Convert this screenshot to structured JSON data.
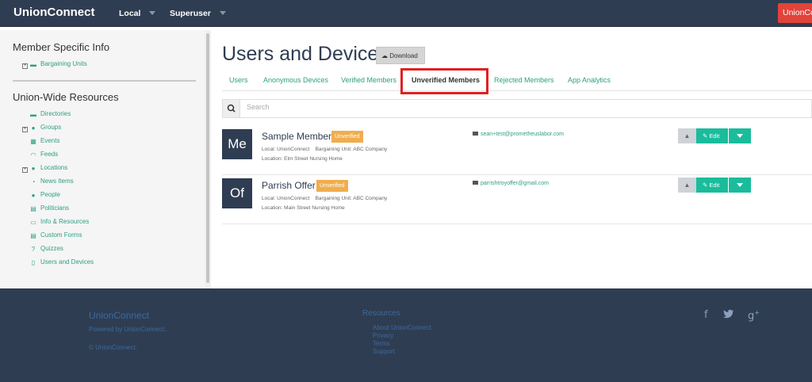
{
  "navbar": {
    "brand": "UnionConnect",
    "local_dropdown": "Local",
    "user_dropdown": "Superuser",
    "right_button": "UnionCo"
  },
  "sidebar": {
    "member_specific_heading": "Member Specific Info",
    "member_specific_items": [
      {
        "label": "Bargaining Units",
        "icon": "book-icon"
      }
    ],
    "union_wide_heading": "Union-Wide Resources",
    "union_wide_items": [
      {
        "label": "Directories",
        "icon": "book-icon"
      },
      {
        "label": "Groups",
        "icon": "users-icon"
      },
      {
        "label": "Events",
        "icon": "calendar-icon"
      },
      {
        "label": "Feeds",
        "icon": "rss-icon"
      },
      {
        "label": "Locations",
        "icon": "globe-icon"
      },
      {
        "label": "News Items",
        "icon": "clock-icon"
      },
      {
        "label": "People",
        "icon": "person-icon"
      },
      {
        "label": "Politicians",
        "icon": "document-icon"
      },
      {
        "label": "Info & Resources",
        "icon": "folder-icon"
      },
      {
        "label": "Custom Forms",
        "icon": "list-icon"
      },
      {
        "label": "Quizzes",
        "icon": "question-icon"
      },
      {
        "label": "Users and Devices",
        "icon": "device-icon"
      }
    ]
  },
  "main": {
    "title": "Users and Devices",
    "download_label": "Download",
    "tabs": [
      {
        "label": "Users"
      },
      {
        "label": "Anonymous Devices"
      },
      {
        "label": "Verified Members"
      },
      {
        "label": "Unverified Members"
      },
      {
        "label": "Rejected Members"
      },
      {
        "label": "App Analytics"
      }
    ],
    "active_tab": "Unverified Members",
    "search_placeholder": "Search",
    "members": [
      {
        "initials": "Me",
        "name": "Sample Member",
        "badge": "Unverified",
        "local": "Local: UnionConnect",
        "bargaining_unit": "Bargaining Unit: ABC Company",
        "location": "Location: Elm Street Nursing Home",
        "email": "sean+test@prometheuslabor.com",
        "edit_label": "Edit"
      },
      {
        "initials": "Of",
        "name": "Parrish Offer",
        "badge": "Unverified",
        "local": "Local: UnionConnect",
        "bargaining_unit": "Bargaining Unit: ABC Company",
        "location": "Location: Main Street Nursing Home",
        "email": "parrishtroyoffer@gmail.com",
        "edit_label": "Edit"
      }
    ]
  },
  "footer": {
    "brand": "UnionConnect",
    "powered_by": "Powered by UnionConnect.",
    "copyright": "© UnionConnect.",
    "resources_heading": "Resources",
    "links": [
      "About UnionConnect",
      "Privacy",
      "Terms",
      "Support"
    ],
    "social_icons": [
      "facebook-icon",
      "twitter-icon",
      "google-plus-icon"
    ]
  },
  "colors": {
    "navy": "#2f3d52",
    "accent_green": "#1abc9c",
    "link_green": "#2e9e83",
    "badge_orange": "#f0ad4e",
    "highlight_red": "#e02020",
    "nav_button_red": "#e2433a"
  }
}
